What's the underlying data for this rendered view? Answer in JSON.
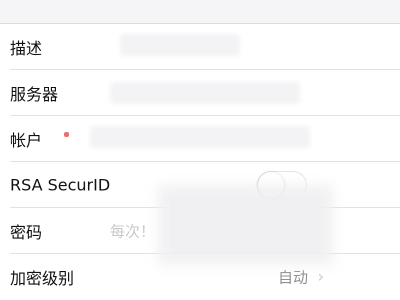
{
  "form": {
    "rows": [
      {
        "label": "描述",
        "placeholder": ""
      },
      {
        "label": "服务器",
        "placeholder": ""
      },
      {
        "label": "帐户",
        "placeholder": ""
      },
      {
        "label": "RSA SecurID",
        "toggle_on": false
      },
      {
        "label": "密码",
        "placeholder": "每次！"
      },
      {
        "label": "加密级别",
        "value": "自动"
      }
    ]
  },
  "colors": {
    "separator": "#e2e2e6",
    "label_text": "#111111",
    "secondary_text": "#8e8e93",
    "chevron": "#c7c7cc",
    "placeholder_text": "#c9c9cc",
    "background": "#ffffff"
  },
  "icons": {
    "chevron": "chevron-right-icon"
  }
}
